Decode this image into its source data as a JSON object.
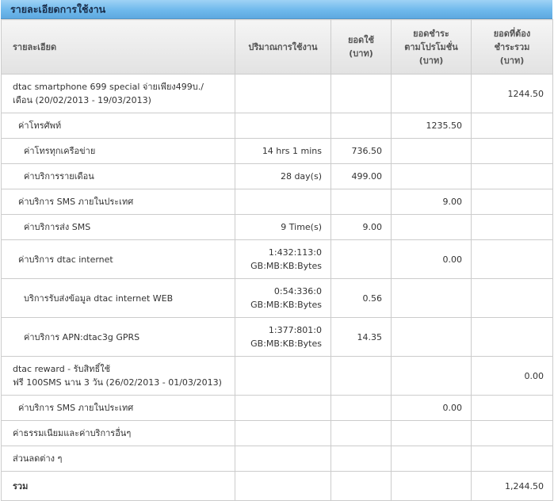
{
  "title": "รายละเอียดการใช้งาน",
  "columns": {
    "detail": "รายละเอียด",
    "usage": "ปริมาณการใช้งาน",
    "amount_l1": "ยอดใช้",
    "amount_l2": "(บาท)",
    "promo_l1": "ยอดชำระ",
    "promo_l2": "ตามโปรโมชั่น",
    "promo_l3": "(บาท)",
    "total_l1": "ยอดที่ต้อง",
    "total_l2": "ชำระรวม",
    "total_l3": "(บาท)"
  },
  "rows": [
    {
      "desc1": "dtac smartphone 699 special จ่ายเพียง499บ./",
      "desc2": "เดือน (20/02/2013 - 19/03/2013)",
      "usage1": "",
      "usage2": "",
      "amount": "",
      "promo": "",
      "total": "1244.50"
    },
    {
      "desc1": "ค่าโทรศัพท์",
      "desc2": "",
      "usage1": "",
      "usage2": "",
      "amount": "",
      "promo": "1235.50",
      "total": ""
    },
    {
      "desc1": "ค่าโทรทุกเครือข่าย",
      "desc2": "",
      "usage1": "14 hrs 1 mins",
      "usage2": "",
      "amount": "736.50",
      "promo": "",
      "total": ""
    },
    {
      "desc1": "ค่าบริการรายเดือน",
      "desc2": "",
      "usage1": "28 day(s)",
      "usage2": "",
      "amount": "499.00",
      "promo": "",
      "total": ""
    },
    {
      "desc1": "ค่าบริการ SMS ภายในประเทศ",
      "desc2": "",
      "usage1": "",
      "usage2": "",
      "amount": "",
      "promo": "9.00",
      "total": ""
    },
    {
      "desc1": "ค่าบริการส่ง SMS",
      "desc2": "",
      "usage1": "9 Time(s)",
      "usage2": "",
      "amount": "9.00",
      "promo": "",
      "total": ""
    },
    {
      "desc1": "ค่าบริการ dtac internet",
      "desc2": "",
      "usage1": "1:432:113:0",
      "usage2": "GB:MB:KB:Bytes",
      "amount": "",
      "promo": "0.00",
      "total": ""
    },
    {
      "desc1": "บริการรับส่งข้อมูล dtac internet WEB",
      "desc2": "",
      "usage1": "0:54:336:0",
      "usage2": "GB:MB:KB:Bytes",
      "amount": "0.56",
      "promo": "",
      "total": ""
    },
    {
      "desc1": "ค่าบริการ APN:dtac3g GPRS",
      "desc2": "",
      "usage1": "1:377:801:0",
      "usage2": "GB:MB:KB:Bytes",
      "amount": "14.35",
      "promo": "",
      "total": ""
    },
    {
      "desc1": "dtac reward - รับสิทธิ์ใช้",
      "desc2": "ฟรี 100SMS นาน 3 วัน (26/02/2013 - 01/03/2013)",
      "usage1": "",
      "usage2": "",
      "amount": "",
      "promo": "",
      "total": "0.00"
    },
    {
      "desc1": "ค่าบริการ SMS ภายในประเทศ",
      "desc2": "",
      "usage1": "",
      "usage2": "",
      "amount": "",
      "promo": "0.00",
      "total": ""
    },
    {
      "desc1": "ค่าธรรมเนียมและค่าบริการอื่นๆ",
      "desc2": "",
      "usage1": "",
      "usage2": "",
      "amount": "",
      "promo": "",
      "total": ""
    },
    {
      "desc1": "ส่วนลดต่าง ๆ",
      "desc2": "",
      "usage1": "",
      "usage2": "",
      "amount": "",
      "promo": "",
      "total": ""
    },
    {
      "desc1": "รวม",
      "desc2": "",
      "usage1": "",
      "usage2": "",
      "amount": "",
      "promo": "",
      "total": "1,244.50"
    }
  ]
}
